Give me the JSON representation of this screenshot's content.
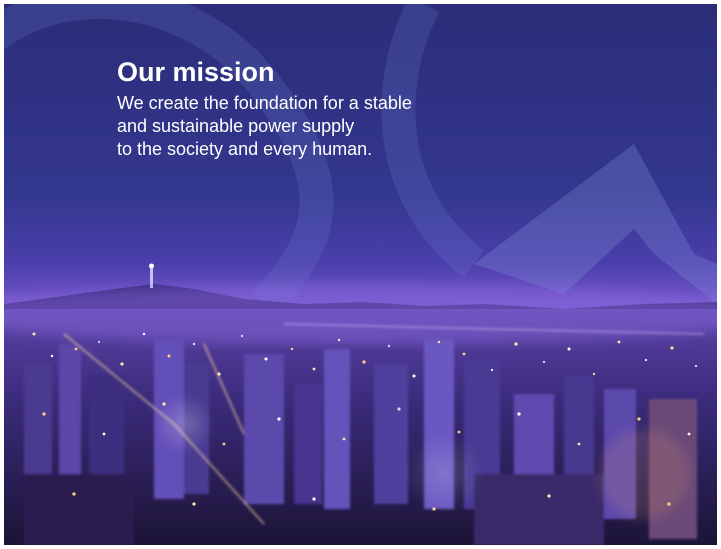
{
  "mission": {
    "title": "Our mission",
    "lines": [
      "We create the foundation for a stable",
      "and sustainable power supply",
      "to the society and every human."
    ]
  },
  "scene": {
    "description_icon": "city-night-skyline",
    "colors": {
      "sky_top": "#2c2f7a",
      "sky_mid": "#4a3ea8",
      "haze": "#7a5ad0",
      "city_dark": "#1e1640",
      "light_warm": "#ffd28a",
      "light_cool": "#cfd8ff",
      "watermark": "#6f7fd0"
    }
  }
}
